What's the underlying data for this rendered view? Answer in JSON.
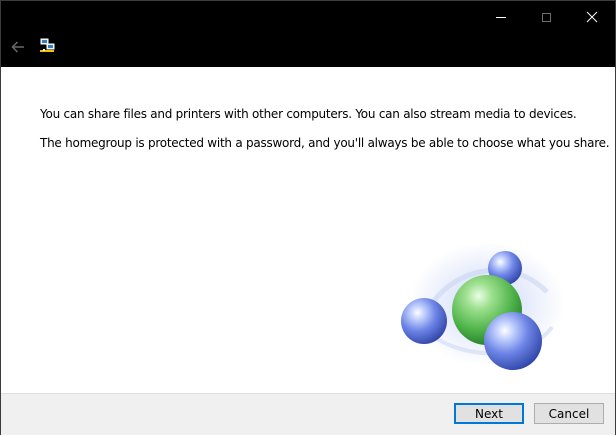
{
  "window": {
    "controls": {
      "minimize": "minimize-icon",
      "maximize": "maximize-icon",
      "close": "close-icon"
    },
    "back_icon": "back-arrow-icon",
    "app_icon": "homegroup-icon"
  },
  "content": {
    "line1": "You can share files and printers with other computers. You can also stream media to devices.",
    "line2": "The homegroup is protected with a password, and you'll always be able to choose what you share.",
    "illustration": "homegroup-spheres-illustration"
  },
  "footer": {
    "next_label": "Next",
    "cancel_label": "Cancel"
  },
  "colors": {
    "titlebar": "#000000",
    "accent": "#0078d7",
    "content_bg": "#ffffff",
    "footer_bg": "#f0f0f0"
  }
}
